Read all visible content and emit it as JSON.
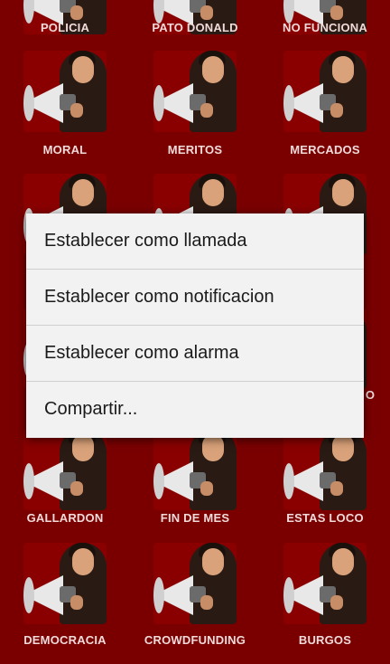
{
  "grid": {
    "rows": [
      [
        "POLICIA",
        "PATO DONALD",
        "NO FUNCIONA"
      ],
      [
        "MORAL",
        "MERITOS",
        "MERCADOS"
      ],
      [
        "",
        "",
        ""
      ],
      [
        "",
        "",
        "O"
      ],
      [
        "GALLARDON",
        "FIN DE MES",
        "ESTAS LOCO"
      ],
      [
        "DEMOCRACIA",
        "CROWDFUNDING",
        "BURGOS"
      ]
    ]
  },
  "dialog": {
    "items": [
      "Establecer como llamada",
      "Establecer como notificacion",
      "Establecer como alarma",
      "Compartir..."
    ]
  },
  "colors": {
    "background": "#7a0000",
    "dialog_bg": "#f2f2f2",
    "label": "#f0dada"
  }
}
